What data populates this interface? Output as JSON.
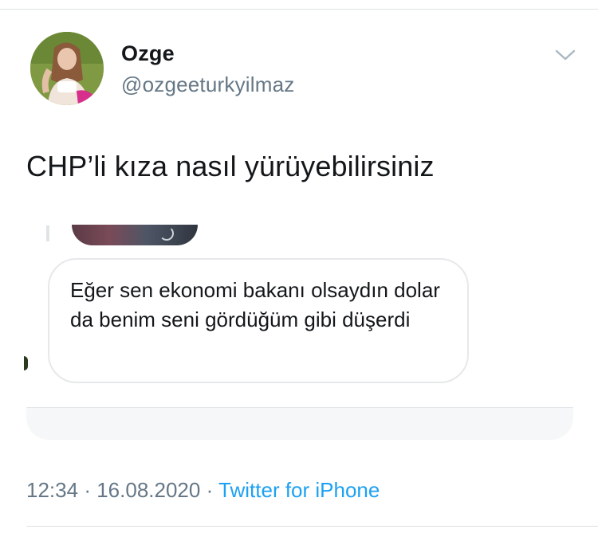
{
  "tweet": {
    "author": {
      "display_name": "Ozge",
      "handle": "@ozgeeturkyilmaz"
    },
    "text": "CHP’li kıza nasıl yürüyebilirsiniz",
    "screenshot_message": "Eğer sen ekonomi bakanı olsaydın dolar da benim seni gördüğüm gibi düşerdi",
    "time": "12:34",
    "separator": "·",
    "date": "16.08.2020",
    "source": "Twitter for iPhone"
  },
  "icons": {
    "menu": "chevron-down-icon"
  },
  "colors": {
    "text": "#14171a",
    "secondary": "#657786",
    "link": "#1da1f2"
  }
}
